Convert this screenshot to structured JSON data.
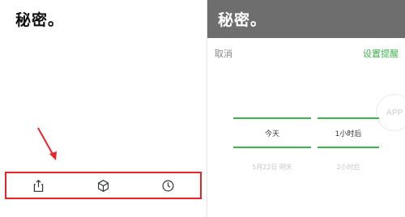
{
  "left": {
    "note_text": "秘密。",
    "annotation_color": "#e8242b",
    "toolbar": {
      "items": [
        {
          "icon": "share-icon"
        },
        {
          "icon": "cube-icon"
        },
        {
          "icon": "clock-icon"
        }
      ]
    }
  },
  "right": {
    "note_text": "秘密。",
    "cancel_label": "取消",
    "set_reminder_label": "设置提醒",
    "accent_color": "#3cb44b",
    "date_picker": {
      "selected": "今天",
      "next": "5月22日 明天"
    },
    "time_picker": {
      "selected": "1小时后",
      "next": "2小时后"
    },
    "watermark_text": "APP"
  }
}
